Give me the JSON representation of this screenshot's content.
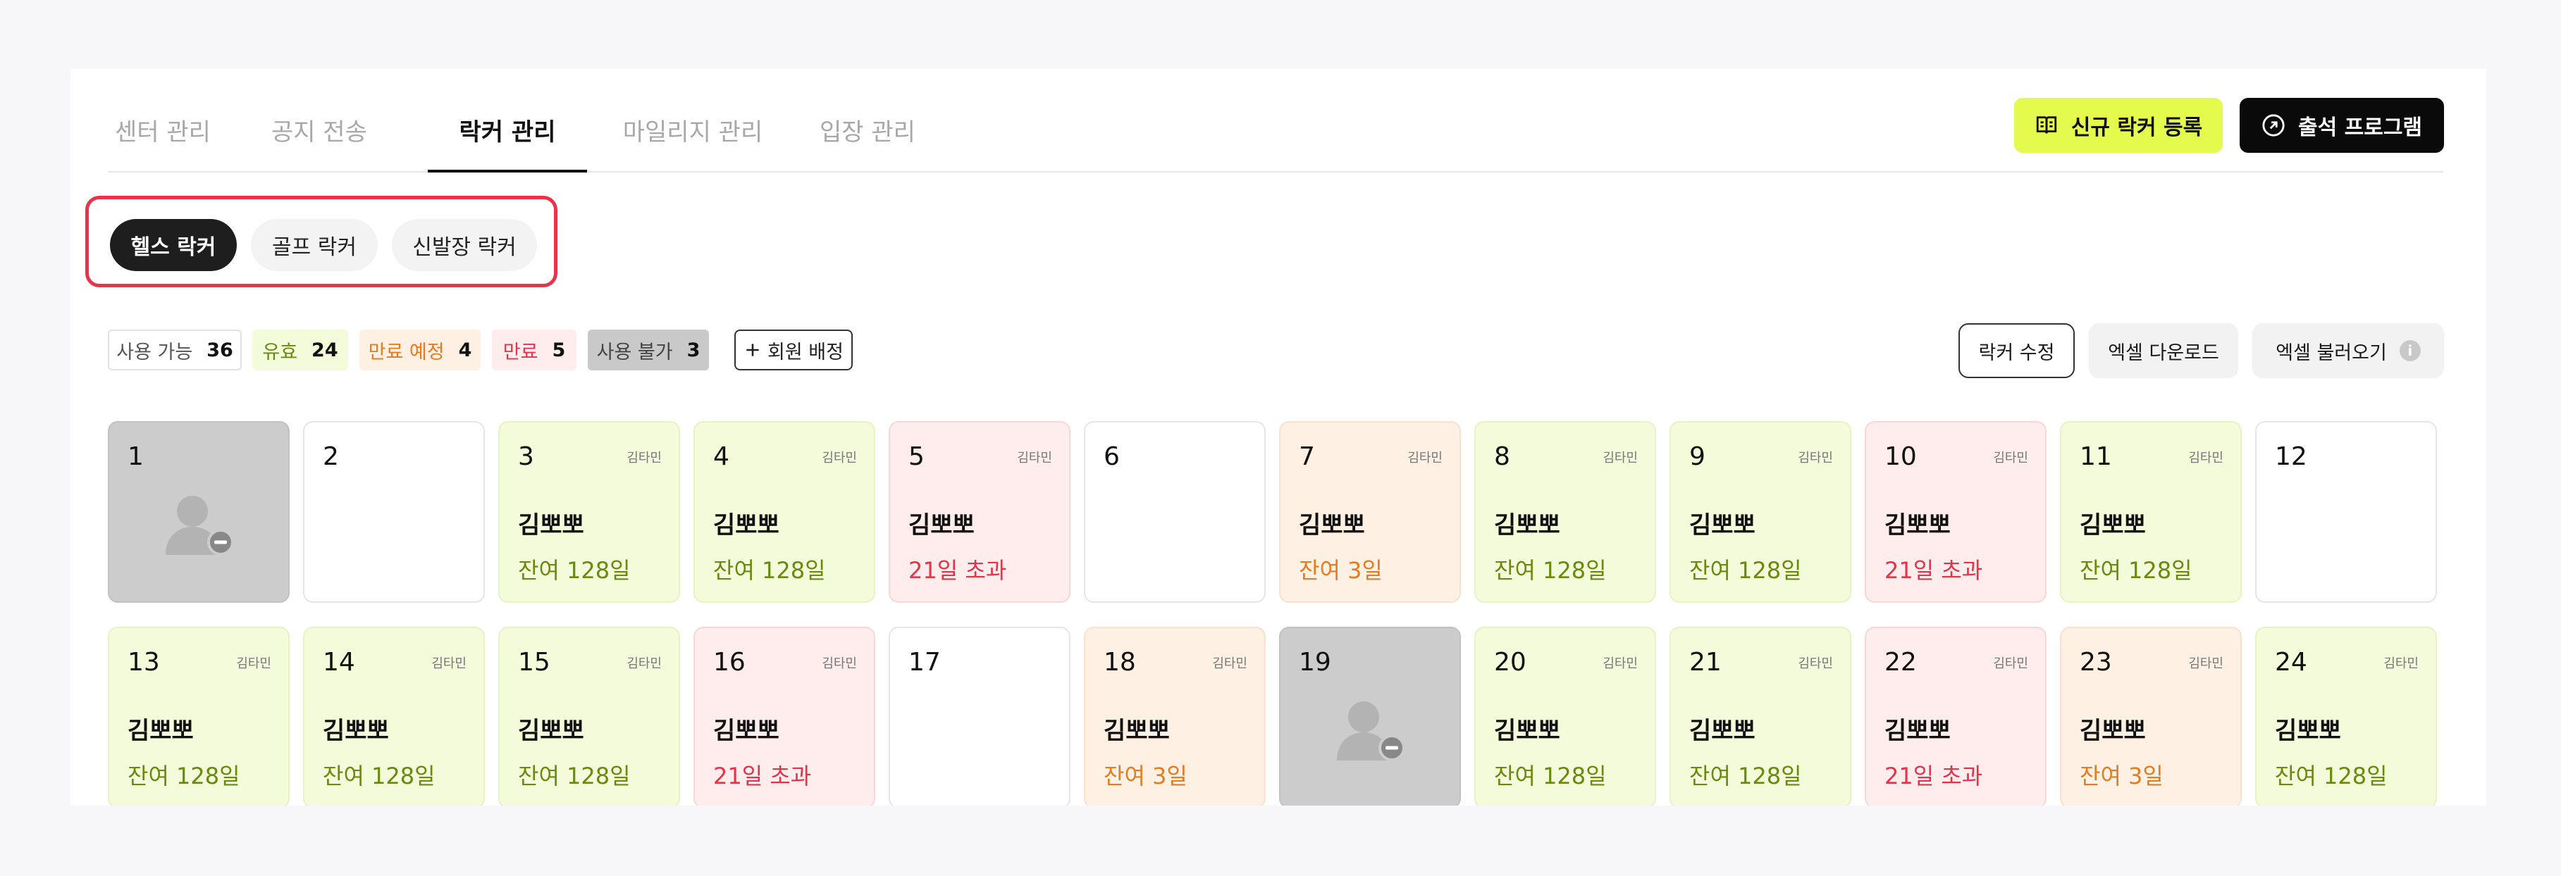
{
  "tabs": [
    {
      "label": "센터 관리"
    },
    {
      "label": "공지 전송"
    },
    {
      "label": "락커 관리"
    },
    {
      "label": "마일리지 관리"
    },
    {
      "label": "입장 관리"
    }
  ],
  "active_tab": "락커 관리",
  "header_buttons": {
    "new_locker": {
      "label": "신규 락커 등록",
      "icon": "book-icon"
    },
    "attendance": {
      "label": "출석 프로그램",
      "icon": "external-link-circle-icon"
    }
  },
  "locker_types": [
    {
      "label": "헬스 락커",
      "active": true
    },
    {
      "label": "골프 락커",
      "active": false
    },
    {
      "label": "신발장 락커",
      "active": false
    }
  ],
  "legend": {
    "available": {
      "label": "사용 가능",
      "count": "36"
    },
    "valid": {
      "label": "유효",
      "count": "24"
    },
    "expiring": {
      "label": "만료 예정",
      "count": "4"
    },
    "expired": {
      "label": "만료",
      "count": "5"
    },
    "unavailable": {
      "label": "사용 불가",
      "count": "3"
    }
  },
  "assign_button": {
    "label": "회원 배정",
    "icon": "plus-icon"
  },
  "toolbar": {
    "edit_label": "락커 수정",
    "excel_download_label": "엑셀 다운로드",
    "excel_upload_label": "엑셀 불러오기",
    "info_icon": "info-icon"
  },
  "colors": {
    "accent_lime": "#e4fb4e",
    "valid_bg": "#f4fbdb",
    "valid_text": "#6a8a0e",
    "soon_bg": "#fff0e4",
    "soon_text": "#e57c1f",
    "expired_bg": "#ffecec",
    "expired_text": "#e2344b",
    "unavailable_bg": "#cccccc",
    "highlight_border": "#e8334a"
  },
  "lockers": [
    {
      "number": "1",
      "status": "na"
    },
    {
      "number": "2",
      "status": "empty"
    },
    {
      "number": "3",
      "status": "valid",
      "staff": "김타민",
      "member": "김뽀뽀",
      "remaining": "잔여 128일"
    },
    {
      "number": "4",
      "status": "valid",
      "staff": "김타민",
      "member": "김뽀뽀",
      "remaining": "잔여 128일"
    },
    {
      "number": "5",
      "status": "expired",
      "staff": "김타민",
      "member": "김뽀뽀",
      "remaining": "21일 초과"
    },
    {
      "number": "6",
      "status": "empty"
    },
    {
      "number": "7",
      "status": "soon",
      "staff": "김타민",
      "member": "김뽀뽀",
      "remaining": "잔여 3일"
    },
    {
      "number": "8",
      "status": "valid",
      "staff": "김타민",
      "member": "김뽀뽀",
      "remaining": "잔여 128일"
    },
    {
      "number": "9",
      "status": "valid",
      "staff": "김타민",
      "member": "김뽀뽀",
      "remaining": "잔여 128일"
    },
    {
      "number": "10",
      "status": "expired",
      "staff": "김타민",
      "member": "김뽀뽀",
      "remaining": "21일 초과"
    },
    {
      "number": "11",
      "status": "valid",
      "staff": "김타민",
      "member": "김뽀뽀",
      "remaining": "잔여 128일"
    },
    {
      "number": "12",
      "status": "empty"
    },
    {
      "number": "13",
      "status": "valid",
      "staff": "김타민",
      "member": "김뽀뽀",
      "remaining": "잔여 128일"
    },
    {
      "number": "14",
      "status": "valid",
      "staff": "김타민",
      "member": "김뽀뽀",
      "remaining": "잔여 128일"
    },
    {
      "number": "15",
      "status": "valid",
      "staff": "김타민",
      "member": "김뽀뽀",
      "remaining": "잔여 128일"
    },
    {
      "number": "16",
      "status": "expired",
      "staff": "김타민",
      "member": "김뽀뽀",
      "remaining": "21일 초과"
    },
    {
      "number": "17",
      "status": "empty"
    },
    {
      "number": "18",
      "status": "soon",
      "staff": "김타민",
      "member": "김뽀뽀",
      "remaining": "잔여 3일"
    },
    {
      "number": "19",
      "status": "na"
    },
    {
      "number": "20",
      "status": "valid",
      "staff": "김타민",
      "member": "김뽀뽀",
      "remaining": "잔여 128일"
    },
    {
      "number": "21",
      "status": "valid",
      "staff": "김타민",
      "member": "김뽀뽀",
      "remaining": "잔여 128일"
    },
    {
      "number": "22",
      "status": "expired",
      "staff": "김타민",
      "member": "김뽀뽀",
      "remaining": "21일 초과"
    },
    {
      "number": "23",
      "status": "soon",
      "staff": "김타민",
      "member": "김뽀뽀",
      "remaining": "잔여 3일"
    },
    {
      "number": "24",
      "status": "valid",
      "staff": "김타민",
      "member": "김뽀뽀",
      "remaining": "잔여 128일"
    }
  ]
}
